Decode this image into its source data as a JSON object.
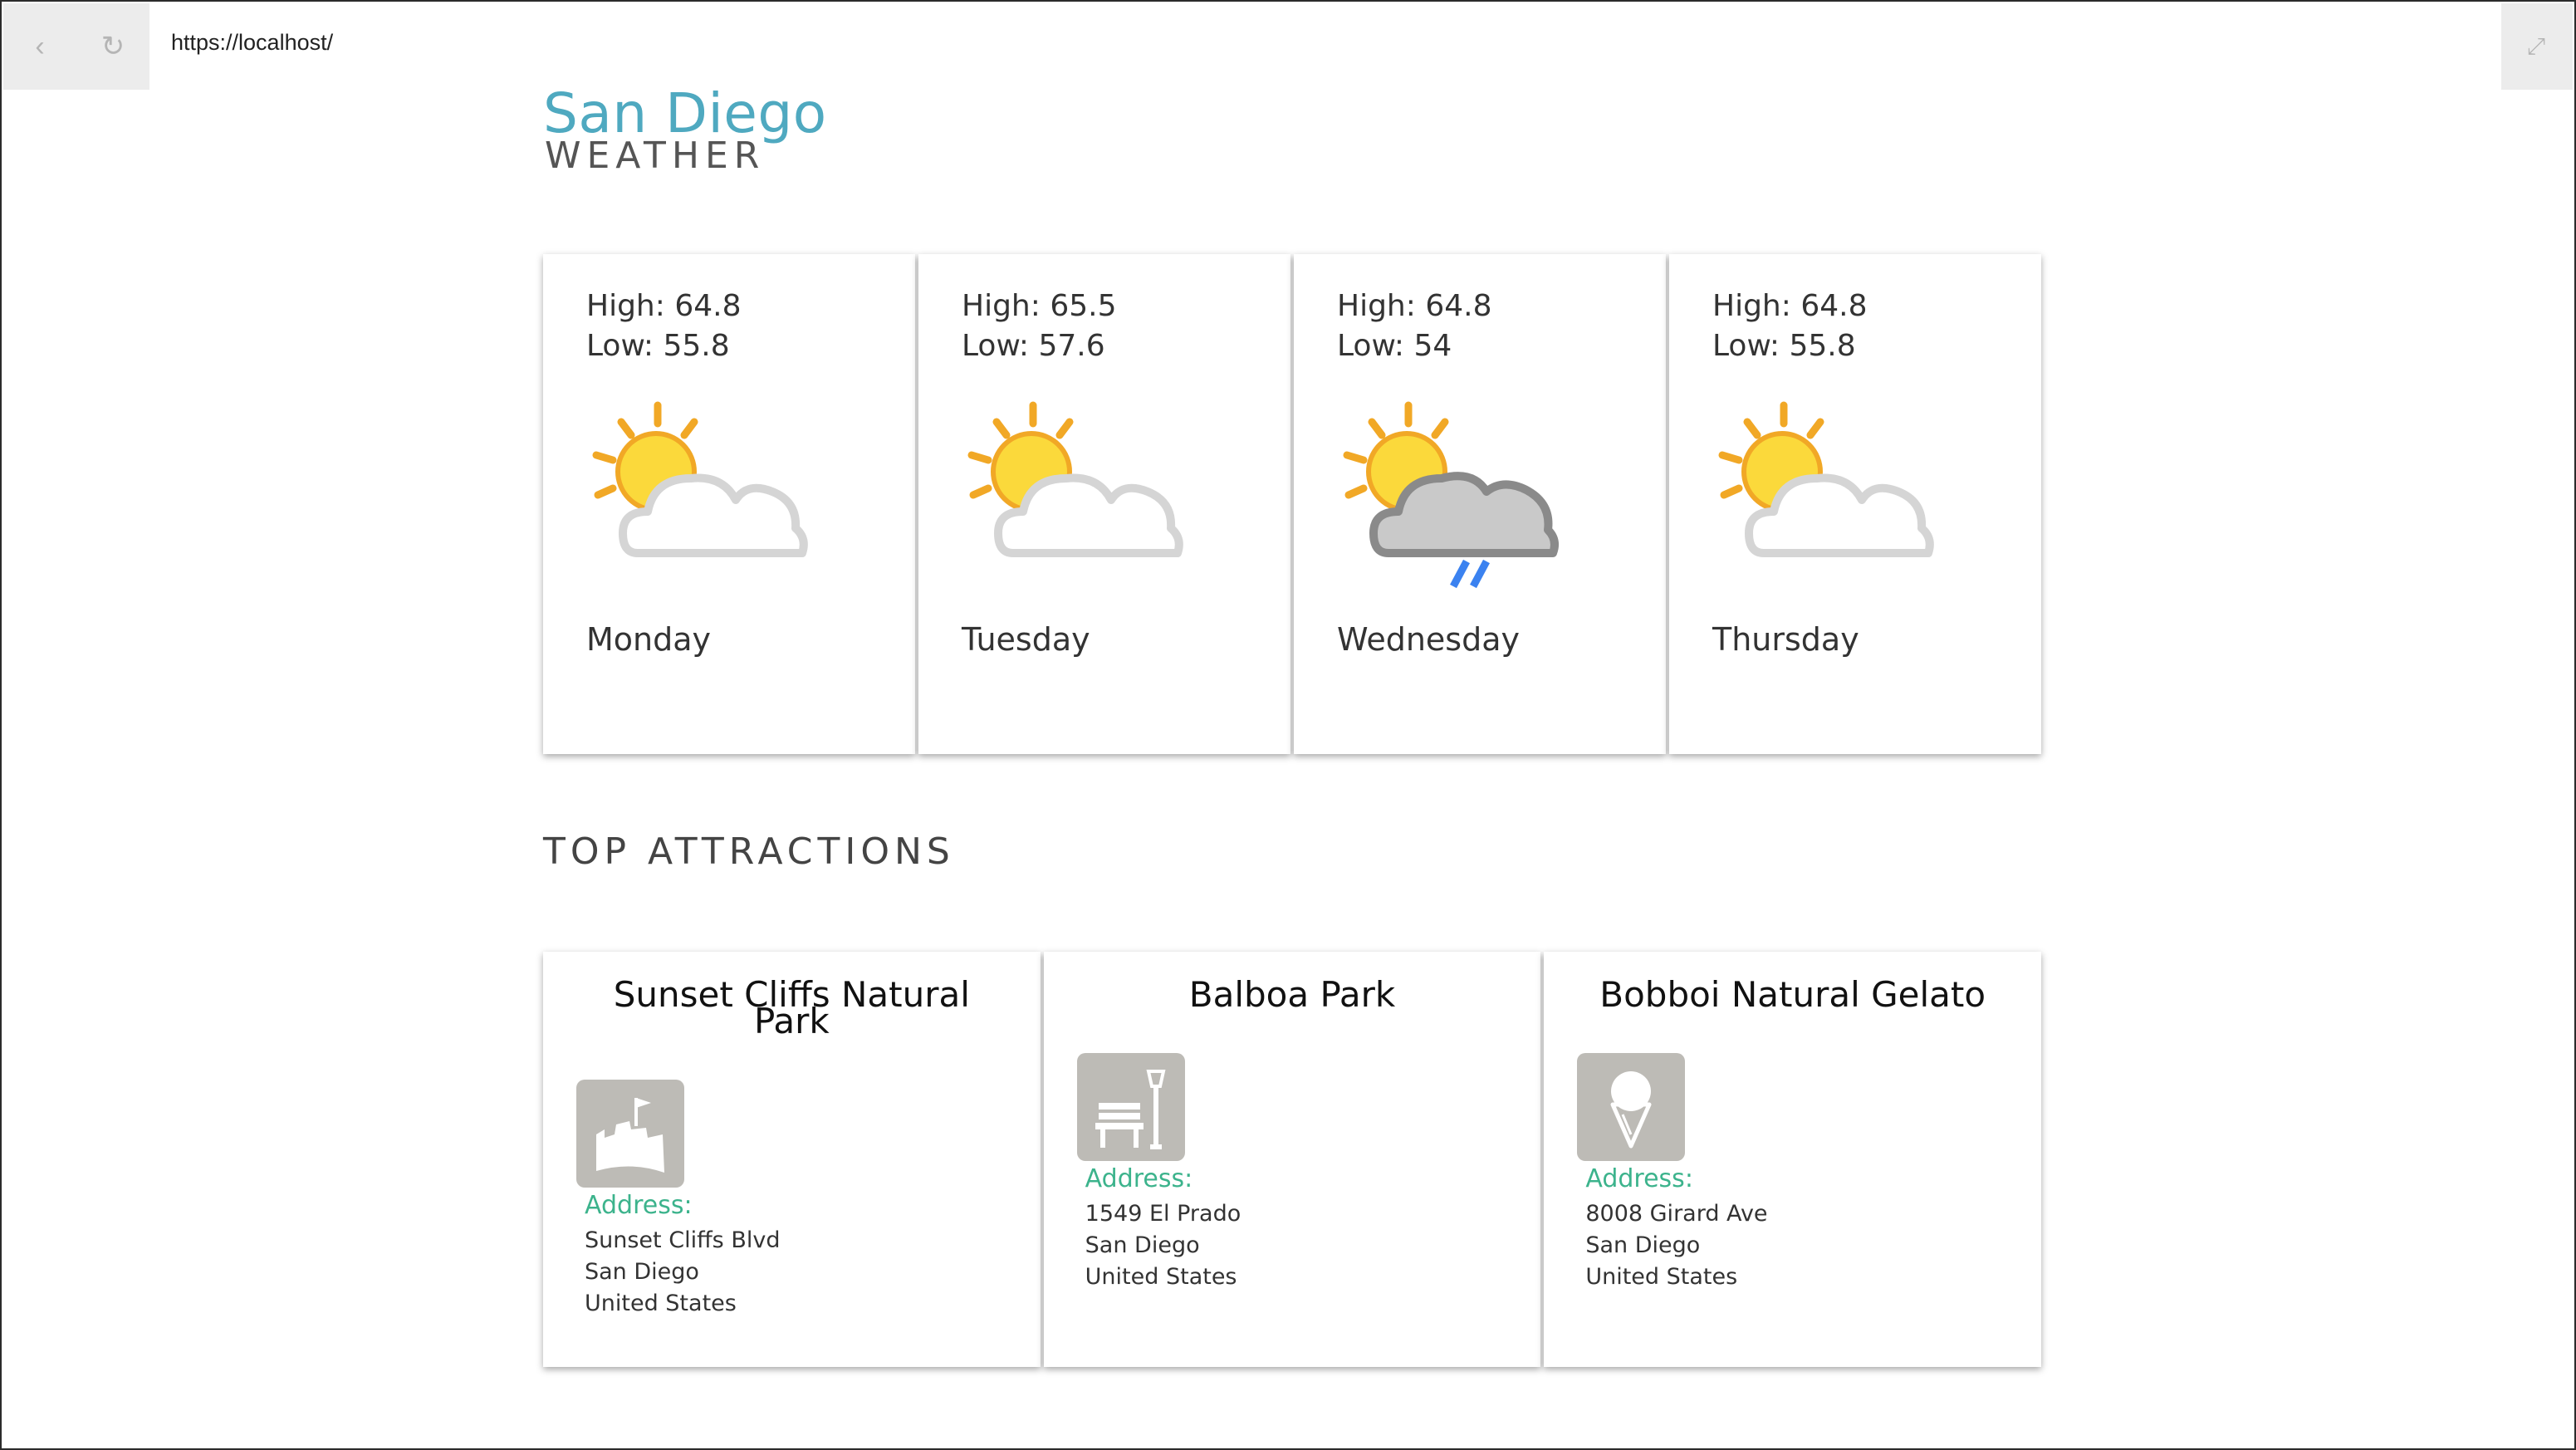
{
  "browser": {
    "url": "https://localhost/",
    "back_icon": "chevron-left-icon",
    "reload_icon": "reload-icon",
    "expand_icon": "expand-icon"
  },
  "header": {
    "city": "San Diego",
    "subtitle": "WEATHER"
  },
  "colors": {
    "city": "#4fa9c0",
    "address_label": "#3cb38c",
    "icon_tile": "#bdbbb6"
  },
  "forecast": [
    {
      "high": "High: 64.8",
      "low": "Low: 55.8",
      "day": "Monday",
      "icon": "partly-cloudy-icon"
    },
    {
      "high": "High: 65.5",
      "low": "Low: 57.6",
      "day": "Tuesday",
      "icon": "partly-cloudy-icon"
    },
    {
      "high": "High: 64.8",
      "low": "Low: 54",
      "day": "Wednesday",
      "icon": "rain-showers-icon"
    },
    {
      "high": "High: 64.8",
      "low": "Low: 55.8",
      "day": "Thursday",
      "icon": "partly-cloudy-icon"
    }
  ],
  "attractions_title": "TOP ATTRACTIONS",
  "attractions": [
    {
      "name": "Sunset Cliffs Natural Park",
      "icon": "sandcastle-icon",
      "address_label": "Address:",
      "street": "Sunset Cliffs Blvd",
      "city": "San Diego",
      "country": "United States"
    },
    {
      "name": "Balboa Park",
      "icon": "park-bench-icon",
      "address_label": "Address:",
      "street": "1549 El Prado",
      "city": "San Diego",
      "country": "United States"
    },
    {
      "name": "Bobboi Natural Gelato",
      "icon": "ice-cream-icon",
      "address_label": "Address:",
      "street": "8008 Girard Ave",
      "city": "San Diego",
      "country": "United States"
    }
  ]
}
